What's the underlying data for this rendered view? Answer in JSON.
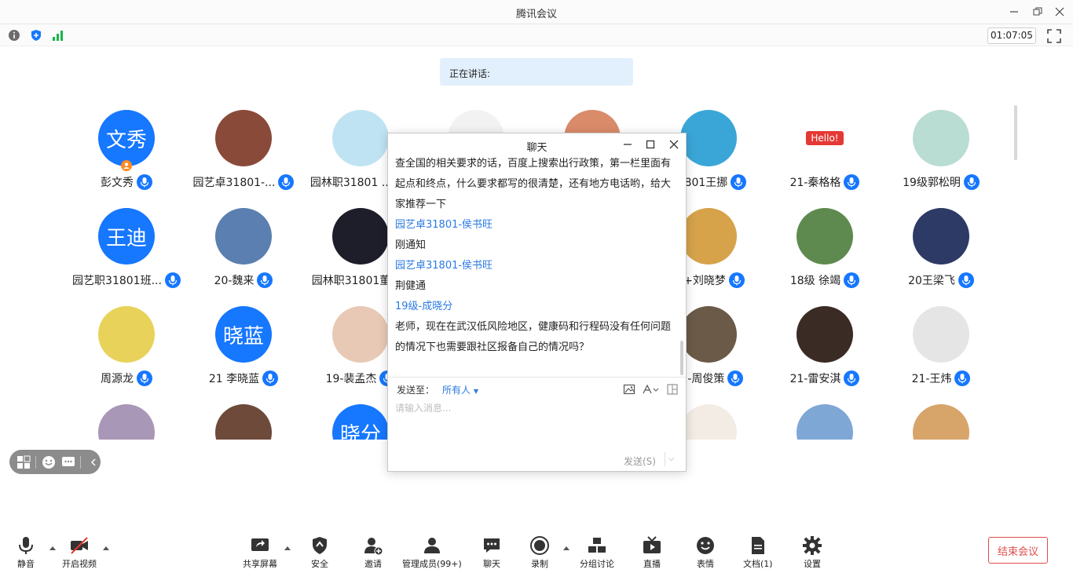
{
  "window": {
    "title": "腾讯会议"
  },
  "infobar": {
    "timer": "01:07:05"
  },
  "speaking": {
    "label": "正在讲话:"
  },
  "colors": {
    "accent": "#1677ff",
    "end_red": "#e04b4b",
    "chat_link": "#2a7ae2"
  },
  "participants": [
    {
      "name": "彭文秀",
      "avatar_text": "文秀",
      "avatar_color": "#1677ff"
    },
    {
      "name": "园艺卓31801-...",
      "avatar_text": "",
      "avatar_color": "#8a4a3a"
    },
    {
      "name": "园林职31801 ...",
      "avatar_text": "",
      "avatar_color": "#bfe3f2"
    },
    {
      "name": "",
      "avatar_text": "",
      "avatar_color": "#f2f2f2"
    },
    {
      "name": "",
      "avatar_text": "",
      "avatar_color": "#d98b6a"
    },
    {
      "name": "31801王挪",
      "avatar_text": "",
      "avatar_color": "#3aa6d8"
    },
    {
      "name": "21-秦格格",
      "avatar_text": "Hello!",
      "avatar_color": "#ffffff"
    },
    {
      "name": "19级郭松明",
      "avatar_text": "",
      "avatar_color": "#b9dcd3"
    },
    {
      "name": "园艺职31801班...",
      "avatar_text": "王迪",
      "avatar_color": "#1677ff"
    },
    {
      "name": "20-魏来",
      "avatar_text": "",
      "avatar_color": "#5a7fb0"
    },
    {
      "name": "园林职31801董",
      "avatar_text": "",
      "avatar_color": "#1e1e2a"
    },
    {
      "name": "",
      "avatar_text": "",
      "avatar_color": "#333333"
    },
    {
      "name": "",
      "avatar_text": "",
      "avatar_color": "#c0c0c0"
    },
    {
      "name": "技+刘晓梦",
      "avatar_text": "",
      "avatar_color": "#d6a24a"
    },
    {
      "name": "18级 徐竭",
      "avatar_text": "",
      "avatar_color": "#5f8a4f"
    },
    {
      "name": "20王梁飞",
      "avatar_text": "",
      "avatar_color": "#2d3a66"
    },
    {
      "name": "周源龙",
      "avatar_text": "",
      "avatar_color": "#e8d25a"
    },
    {
      "name": "21 李晓蓝",
      "avatar_text": "晓蓝",
      "avatar_color": "#1677ff"
    },
    {
      "name": "19-裴孟杰",
      "avatar_text": "",
      "avatar_color": "#e8c9b5"
    },
    {
      "name": "",
      "avatar_text": "",
      "avatar_color": "#dddddd"
    },
    {
      "name": "",
      "avatar_text": "",
      "avatar_color": "#dddddd"
    },
    {
      "name": "21-周俊策",
      "avatar_text": "",
      "avatar_color": "#6b5a48"
    },
    {
      "name": "21-雷安淇",
      "avatar_text": "",
      "avatar_color": "#3b2b25"
    },
    {
      "name": "21-王炜",
      "avatar_text": "",
      "avatar_color": "#e5e5e5"
    },
    {
      "name": "",
      "avatar_text": "",
      "avatar_color": "#a897b7"
    },
    {
      "name": "",
      "avatar_text": "",
      "avatar_color": "#6e4a3a"
    },
    {
      "name": "",
      "avatar_text": "晓分",
      "avatar_color": "#1677ff"
    },
    {
      "name": "",
      "avatar_text": "",
      "avatar_color": "#eeeeee"
    },
    {
      "name": "",
      "avatar_text": "",
      "avatar_color": "#eeeeee"
    },
    {
      "name": "",
      "avatar_text": "",
      "avatar_color": "#f3ece4"
    },
    {
      "name": "",
      "avatar_text": "",
      "avatar_color": "#7fa7d6"
    },
    {
      "name": "",
      "avatar_text": "",
      "avatar_color": "#d7a46a"
    }
  ],
  "chat": {
    "title": "聊天",
    "messages": [
      {
        "type": "text",
        "text": "查全国的相关要求的话，百度上搜索出行政策，第一栏里面有起点和终点，什么要求都写的很清楚，还有地方电话哟，给大家推荐一下"
      },
      {
        "type": "sender",
        "text": "园艺卓31801-侯书旺"
      },
      {
        "type": "text",
        "text": "刚通知"
      },
      {
        "type": "sender",
        "text": "园艺卓31801-侯书旺"
      },
      {
        "type": "text",
        "text": "荆健通"
      },
      {
        "type": "sender",
        "text": "19级-成晓分"
      },
      {
        "type": "text",
        "text": "老师，现在在武汉低风险地区，健康码和行程码没有任何问题的情况下也需要跟社区报备自己的情况吗？"
      }
    ],
    "send_to_label": "发送至：",
    "recipient": "所有人",
    "input_placeholder": "请输入消息...",
    "send_label": "发送(S)"
  },
  "toolbar": {
    "mute": "静音",
    "video": "开启视频",
    "share": "共享屏幕",
    "security": "安全",
    "invite": "邀请",
    "members": "管理成员(99+)",
    "chat": "聊天",
    "record": "录制",
    "breakout": "分组讨论",
    "live": "直播",
    "reaction": "表情",
    "docs": "文档(1)",
    "settings": "设置",
    "end": "结束会议"
  }
}
